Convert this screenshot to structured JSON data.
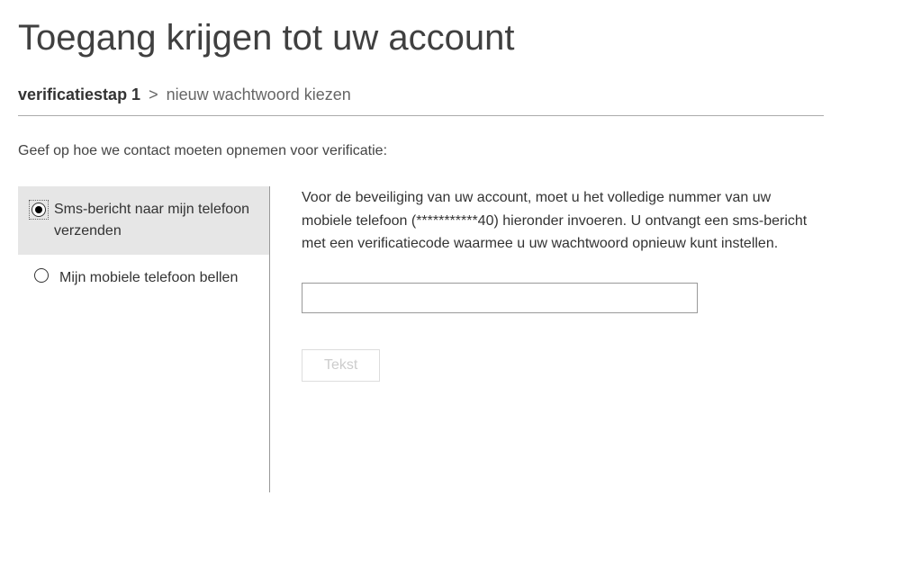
{
  "page": {
    "title": "Toegang krijgen tot uw account"
  },
  "breadcrumb": {
    "current": "verificatiestap 1",
    "separator": ">",
    "next": "nieuw wachtwoord kiezen"
  },
  "instructions": "Geef op hoe we contact moeten opnemen voor verificatie:",
  "options": {
    "sms": {
      "label": "Sms-bericht naar mijn telefoon verzenden",
      "selected": true
    },
    "call": {
      "label": "Mijn mobiele telefoon bellen",
      "selected": false
    }
  },
  "detail": {
    "description": "Voor de beveiliging van uw account, moet u het volledige nummer van uw mobiele telefoon (***********40) hieronder invoeren. U ontvangt een sms-bericht met een verificatiecode waarmee u uw wachtwoord opnieuw kunt instellen.",
    "input_value": "",
    "button_label": "Tekst"
  }
}
